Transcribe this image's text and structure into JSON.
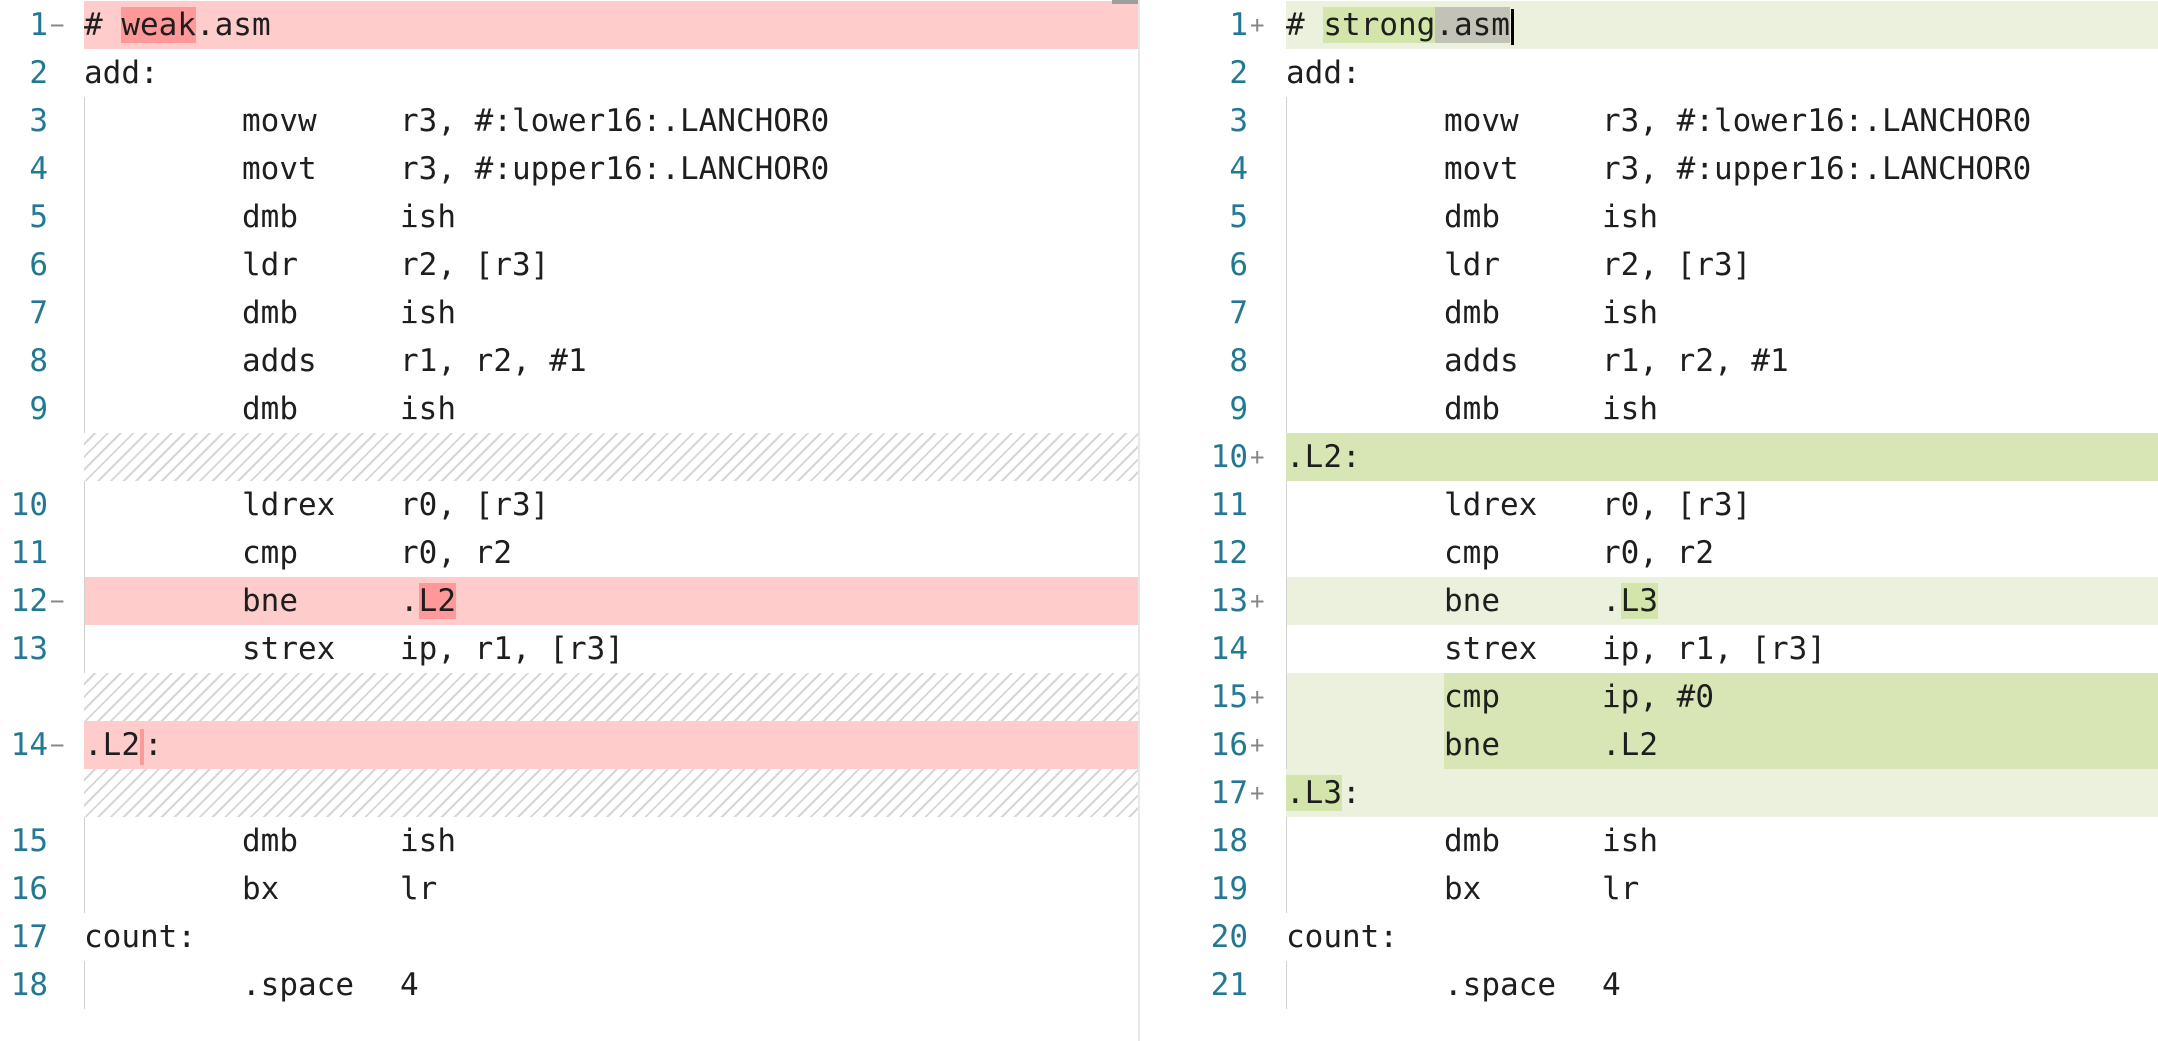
{
  "left": {
    "file": "weak.asm",
    "lines": [
      {
        "n": "1",
        "mark": "−",
        "kind": "del",
        "label": "# ",
        "hl": "weak",
        "rest": ".asm"
      },
      {
        "n": "2",
        "kind": "plain",
        "label": "add:"
      },
      {
        "n": "3",
        "kind": "plain",
        "mn": "movw",
        "op": "r3, #:lower16:.LANCHOR0"
      },
      {
        "n": "4",
        "kind": "plain",
        "mn": "movt",
        "op": "r3, #:upper16:.LANCHOR0"
      },
      {
        "n": "5",
        "kind": "plain",
        "mn": "dmb",
        "op": "ish"
      },
      {
        "n": "6",
        "kind": "plain",
        "mn": "ldr",
        "op": "r2, [r3]"
      },
      {
        "n": "7",
        "kind": "plain",
        "mn": "dmb",
        "op": "ish"
      },
      {
        "n": "8",
        "kind": "plain",
        "mn": "adds",
        "op": "r1, r2, #1"
      },
      {
        "n": "9",
        "kind": "plain",
        "mn": "dmb",
        "op": "ish"
      },
      {
        "kind": "hatch"
      },
      {
        "n": "10",
        "kind": "plain",
        "mn": "ldrex",
        "op": "r0, [r3]"
      },
      {
        "n": "11",
        "kind": "plain",
        "mn": "cmp",
        "op": "r0, r2"
      },
      {
        "n": "12",
        "mark": "−",
        "kind": "del",
        "mn": "bne",
        "op": ".",
        "ophl": "L2"
      },
      {
        "n": "13",
        "kind": "plain",
        "mn": "strex",
        "op": "ip, r1, [r3]"
      },
      {
        "kind": "hatch"
      },
      {
        "n": "14",
        "mark": "−",
        "kind": "del",
        "label": ".L2:"
      },
      {
        "kind": "hatch"
      },
      {
        "n": "15",
        "kind": "plain",
        "mn": "dmb",
        "op": "ish"
      },
      {
        "n": "16",
        "kind": "plain",
        "mn": "bx",
        "op": "lr"
      },
      {
        "n": "17",
        "kind": "plain",
        "label": "count:"
      },
      {
        "n": "18",
        "kind": "plain",
        "mn": ".space",
        "op": "4"
      }
    ]
  },
  "right": {
    "file": "strong.asm",
    "lines": [
      {
        "n": "1",
        "mark": "+",
        "kind": "ins",
        "label": "# ",
        "hl": "strong",
        "rest": ".asm"
      },
      {
        "n": "2",
        "kind": "plain",
        "label": "add:"
      },
      {
        "n": "3",
        "kind": "plain",
        "mn": "movw",
        "op": "r3, #:lower16:.LANCHOR0"
      },
      {
        "n": "4",
        "kind": "plain",
        "mn": "movt",
        "op": "r3, #:upper16:.LANCHOR0"
      },
      {
        "n": "5",
        "kind": "plain",
        "mn": "dmb",
        "op": "ish"
      },
      {
        "n": "6",
        "kind": "plain",
        "mn": "ldr",
        "op": "r2, [r3]"
      },
      {
        "n": "7",
        "kind": "plain",
        "mn": "dmb",
        "op": "ish"
      },
      {
        "n": "8",
        "kind": "plain",
        "mn": "adds",
        "op": "r1, r2, #1"
      },
      {
        "n": "9",
        "kind": "plain",
        "mn": "dmb",
        "op": "ish"
      },
      {
        "n": "10",
        "mark": "+",
        "kind": "insfull",
        "label": ".L2:"
      },
      {
        "n": "11",
        "kind": "plain",
        "mn": "ldrex",
        "op": "r0, [r3]"
      },
      {
        "n": "12",
        "kind": "plain",
        "mn": "cmp",
        "op": "r0, r2"
      },
      {
        "n": "13",
        "mark": "+",
        "kind": "ins",
        "mn": "bne",
        "op": ".",
        "ophl": "L3"
      },
      {
        "n": "14",
        "kind": "plain",
        "mn": "strex",
        "op": "ip, r1, [r3]"
      },
      {
        "n": "15",
        "mark": "+",
        "kind": "insfull-code",
        "mn": "cmp",
        "op": "ip, #0"
      },
      {
        "n": "16",
        "mark": "+",
        "kind": "insfull-code",
        "mn": "bne",
        "op": ".L2"
      },
      {
        "n": "17",
        "mark": "+",
        "kind": "ins-label",
        "label": ".L3:"
      },
      {
        "n": "18",
        "kind": "plain",
        "mn": "dmb",
        "op": "ish"
      },
      {
        "n": "19",
        "kind": "plain",
        "mn": "bx",
        "op": "lr"
      },
      {
        "n": "20",
        "kind": "plain",
        "label": "count:"
      },
      {
        "n": "21",
        "kind": "plain",
        "mn": ".space",
        "op": "4"
      }
    ]
  },
  "colors": {
    "deleted_line": "#ffcccc",
    "deleted_char": "#ff9999",
    "inserted_line": "#ebf1dd",
    "inserted_char": "#d4e5ac",
    "line_number": "#237893"
  }
}
